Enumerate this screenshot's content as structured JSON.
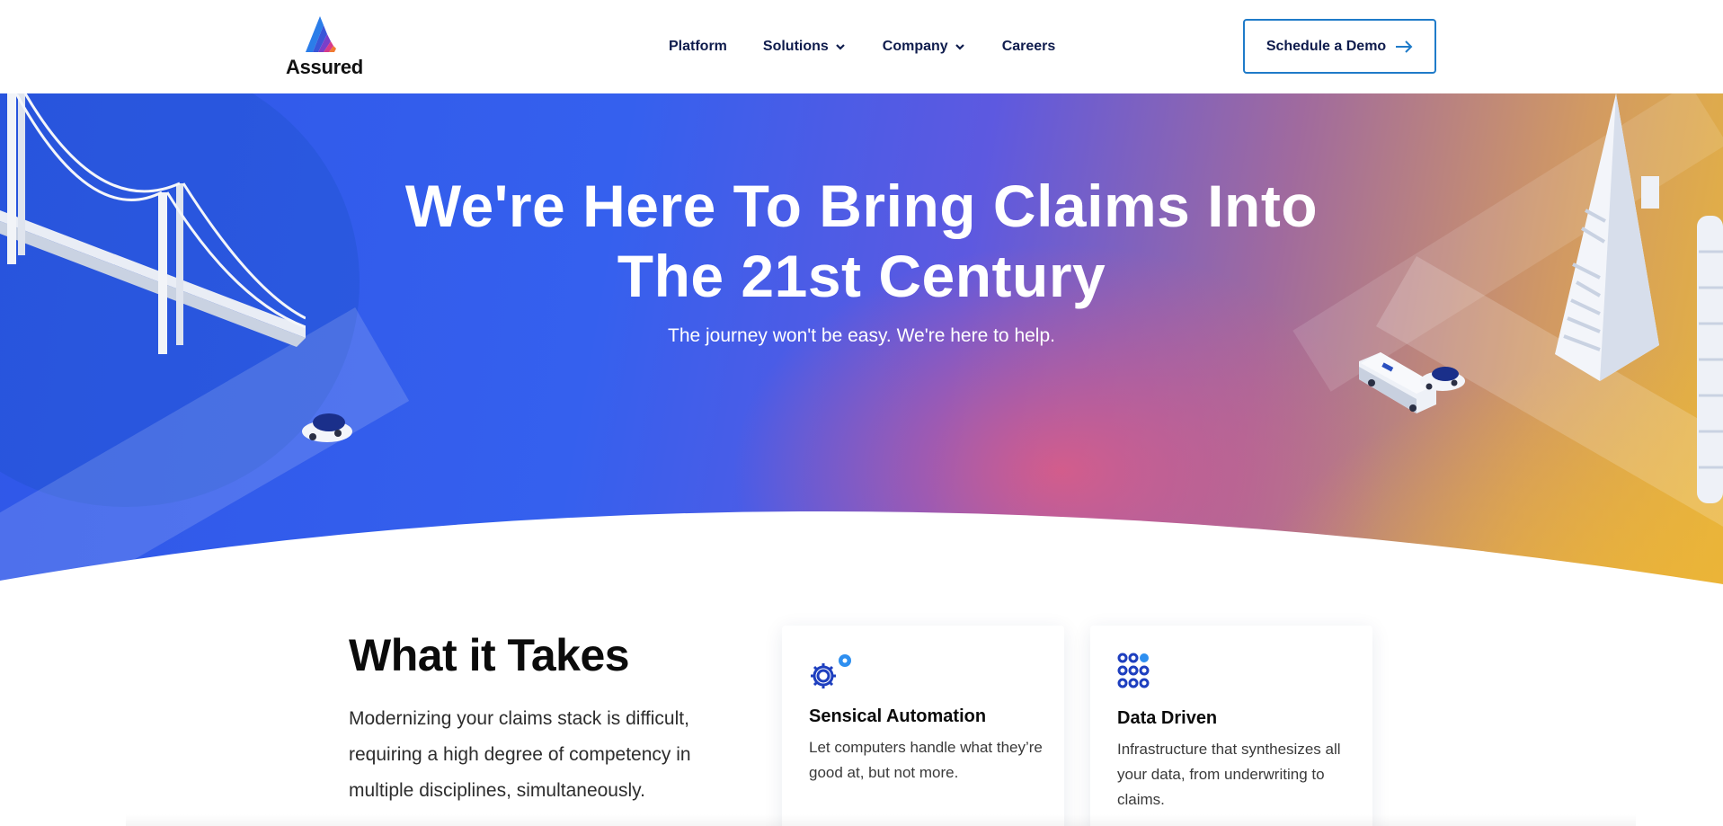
{
  "header": {
    "logo_text": "Assured",
    "nav": [
      {
        "label": "Platform",
        "has_dropdown": false
      },
      {
        "label": "Solutions",
        "has_dropdown": true
      },
      {
        "label": "Company",
        "has_dropdown": true
      },
      {
        "label": "Careers",
        "has_dropdown": false
      }
    ],
    "cta_label": "Schedule a Demo"
  },
  "hero": {
    "title": "We're Here To Bring Claims Into The 21st Century",
    "subtitle": "The journey won't be easy. We're here to help."
  },
  "section": {
    "title": "What it Takes",
    "body": "Modernizing your claims stack is difficult, requiring a high degree of competency in multiple disciplines, simultaneously."
  },
  "cards": [
    {
      "icon": "gears-icon",
      "title": "Sensical Automation",
      "body": "Let computers handle what they’re good at, but not more."
    },
    {
      "icon": "dot-grid-icon",
      "title": "Data Driven",
      "body": "Infrastructure that synthesizes all your data, from underwriting to claims."
    }
  ],
  "colors": {
    "brand_navy": "#0f1c4d",
    "accent_blue": "#1f7bc9",
    "icon_blue": "#1e3fbf",
    "hero_blue": "#2f57e8",
    "hero_gold": "#e7b63d"
  }
}
